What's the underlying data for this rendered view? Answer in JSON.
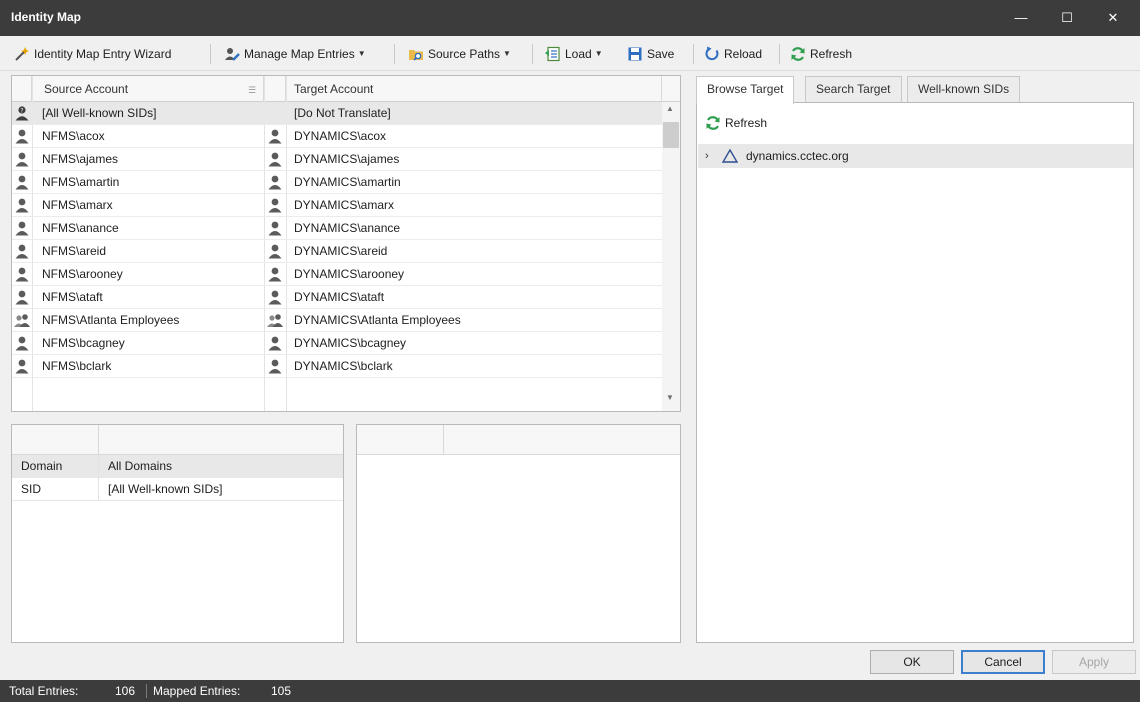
{
  "window": {
    "title": "Identity Map",
    "controls": {
      "minimize": "—",
      "maximize": "☐",
      "close": "✕"
    }
  },
  "toolbar": {
    "wizard_label": "Identity Map Entry Wizard",
    "manage_label": "Manage Map Entries",
    "source_paths_label": "Source Paths",
    "load_label": "Load",
    "save_label": "Save",
    "reload_label": "Reload",
    "refresh_label": "Refresh"
  },
  "grid": {
    "headers": {
      "source": "Source Account",
      "target": "Target Account"
    },
    "rows": [
      {
        "source": "[All Well-known SIDs]",
        "target": "[Do Not Translate]",
        "src_icon": "well-known-sid-icon",
        "tgt_icon": "none"
      },
      {
        "source": "NFMS\\acox",
        "target": "DYNAMICS\\acox",
        "src_icon": "user-icon",
        "tgt_icon": "user-icon"
      },
      {
        "source": "NFMS\\ajames",
        "target": "DYNAMICS\\ajames",
        "src_icon": "user-icon",
        "tgt_icon": "user-icon"
      },
      {
        "source": "NFMS\\amartin",
        "target": "DYNAMICS\\amartin",
        "src_icon": "user-icon",
        "tgt_icon": "user-icon"
      },
      {
        "source": "NFMS\\amarx",
        "target": "DYNAMICS\\amarx",
        "src_icon": "user-icon",
        "tgt_icon": "user-icon"
      },
      {
        "source": "NFMS\\anance",
        "target": "DYNAMICS\\anance",
        "src_icon": "user-icon",
        "tgt_icon": "user-icon"
      },
      {
        "source": "NFMS\\areid",
        "target": "DYNAMICS\\areid",
        "src_icon": "user-icon",
        "tgt_icon": "user-icon"
      },
      {
        "source": "NFMS\\arooney",
        "target": "DYNAMICS\\arooney",
        "src_icon": "user-icon",
        "tgt_icon": "user-icon"
      },
      {
        "source": "NFMS\\ataft",
        "target": "DYNAMICS\\ataft",
        "src_icon": "user-icon",
        "tgt_icon": "user-icon"
      },
      {
        "source": "NFMS\\Atlanta Employees",
        "target": "DYNAMICS\\Atlanta Employees",
        "src_icon": "group-icon",
        "tgt_icon": "group-icon"
      },
      {
        "source": "NFMS\\bcagney",
        "target": "DYNAMICS\\bcagney",
        "src_icon": "user-icon",
        "tgt_icon": "user-icon"
      },
      {
        "source": "NFMS\\bclark",
        "target": "DYNAMICS\\bclark",
        "src_icon": "user-icon",
        "tgt_icon": "user-icon"
      }
    ]
  },
  "details": {
    "rows": [
      {
        "key": "Domain",
        "value": "All Domains"
      },
      {
        "key": "SID",
        "value": "[All Well-known SIDs]"
      }
    ]
  },
  "right": {
    "tabs": [
      "Browse Target",
      "Search Target",
      "Well-known SIDs"
    ],
    "active_tab": "Browse Target",
    "refresh_label": "Refresh",
    "tree": [
      {
        "label": "dynamics.cctec.org",
        "expander": "›"
      }
    ]
  },
  "buttons": {
    "ok": "OK",
    "cancel": "Cancel",
    "apply": "Apply"
  },
  "status": {
    "total_label": "Total Entries:",
    "total_value": "106",
    "mapped_label": "Mapped Entries:",
    "mapped_value": "105"
  },
  "colors": {
    "titlebar": "#3c3c3c",
    "statusbar": "#3c3c3c",
    "selection": "#e8e8e8",
    "accent_blue": "#3c7fcc",
    "refresh_green": "#2e9f4f"
  }
}
